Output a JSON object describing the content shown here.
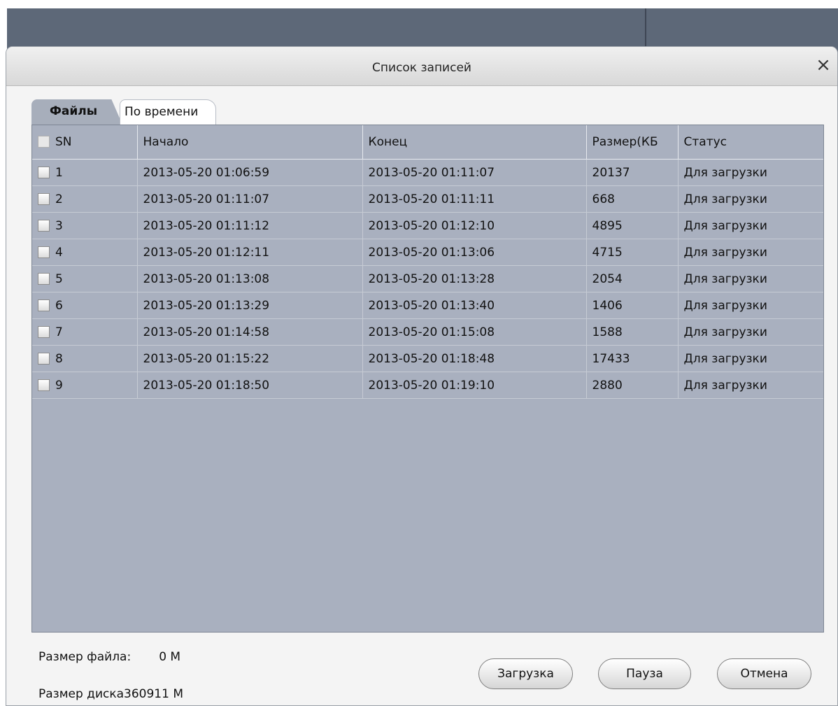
{
  "dialog": {
    "title": "Список записей",
    "close_glyph": "×"
  },
  "tabs": [
    {
      "label": "Файлы",
      "active": true
    },
    {
      "label": "По времени",
      "active": false
    }
  ],
  "table": {
    "columns": [
      "SN",
      "Начало",
      "Конец",
      "Размер(КБ",
      "Статус"
    ],
    "rows": [
      {
        "sn": "1",
        "start": "2013-05-20 01:06:59",
        "end": "2013-05-20 01:11:07",
        "size": "20137",
        "status": "Для загрузки"
      },
      {
        "sn": "2",
        "start": "2013-05-20 01:11:07",
        "end": "2013-05-20 01:11:11",
        "size": "668",
        "status": "Для загрузки"
      },
      {
        "sn": "3",
        "start": "2013-05-20 01:11:12",
        "end": "2013-05-20 01:12:10",
        "size": "4895",
        "status": "Для загрузки"
      },
      {
        "sn": "4",
        "start": "2013-05-20 01:12:11",
        "end": "2013-05-20 01:13:06",
        "size": "4715",
        "status": "Для загрузки"
      },
      {
        "sn": "5",
        "start": "2013-05-20 01:13:08",
        "end": "2013-05-20 01:13:28",
        "size": "2054",
        "status": "Для загрузки"
      },
      {
        "sn": "6",
        "start": "2013-05-20 01:13:29",
        "end": "2013-05-20 01:13:40",
        "size": "1406",
        "status": "Для загрузки"
      },
      {
        "sn": "7",
        "start": "2013-05-20 01:14:58",
        "end": "2013-05-20 01:15:08",
        "size": "1588",
        "status": "Для загрузки"
      },
      {
        "sn": "8",
        "start": "2013-05-20 01:15:22",
        "end": "2013-05-20 01:18:48",
        "size": "17433",
        "status": "Для загрузки"
      },
      {
        "sn": "9",
        "start": "2013-05-20 01:18:50",
        "end": "2013-05-20 01:19:10",
        "size": "2880",
        "status": "Для загрузки"
      }
    ]
  },
  "footer": {
    "file_size_label": "Размер файла:",
    "file_size_value": "0 M",
    "disk_size_label": "Размер диска",
    "disk_size_value": "360911 M"
  },
  "buttons": {
    "download": "Загрузка",
    "pause": "Пауза",
    "cancel": "Отмена"
  }
}
